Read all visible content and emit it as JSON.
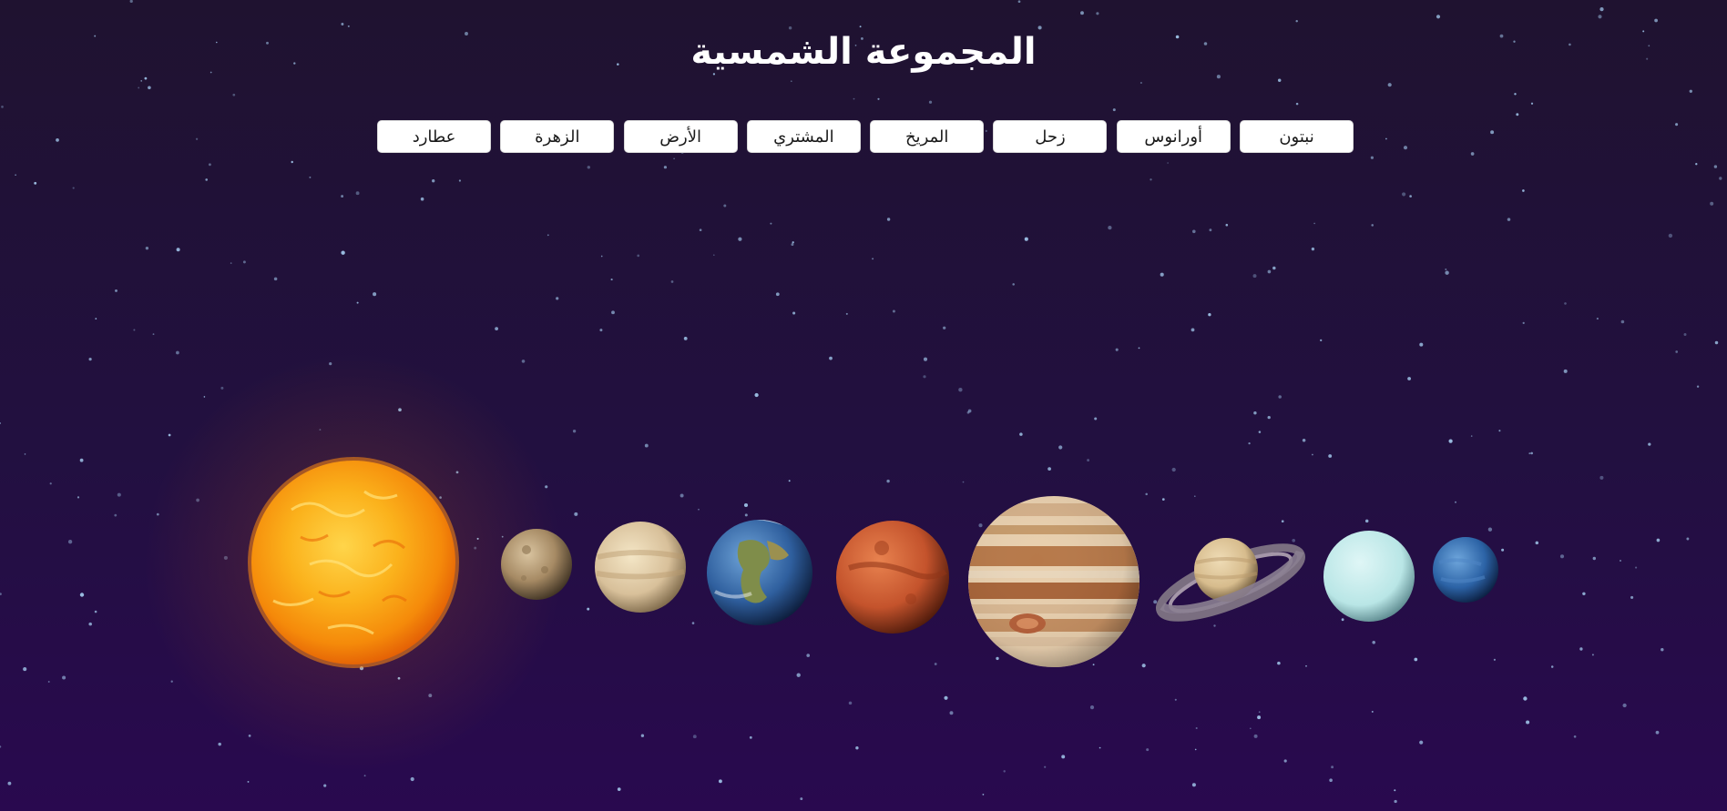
{
  "header": {
    "title": "المجموعة الشمسية"
  },
  "nav": {
    "buttons": [
      {
        "id": "neptune",
        "label": "نبتون"
      },
      {
        "id": "uranus",
        "label": "أورانوس"
      },
      {
        "id": "saturn",
        "label": "زحل"
      },
      {
        "id": "mars",
        "label": "المريخ"
      },
      {
        "id": "jupiter",
        "label": "المشتري"
      },
      {
        "id": "earth",
        "label": "الأرض"
      },
      {
        "id": "venus",
        "label": "الزهرة"
      },
      {
        "id": "mercury",
        "label": "عطارد"
      }
    ]
  },
  "colors": {
    "background_top": "#1f1230",
    "background_bottom": "#29094f",
    "star": "#9fc4e8",
    "sun": "#f7a412",
    "mercury": "#a68a64",
    "venus": "#d8c09a",
    "earth": "#2f5f9e",
    "mars": "#c4532c",
    "jupiter": "#d9b48a",
    "saturn": "#d7bc8d",
    "uranus": "#b9e6e6",
    "neptune": "#2c63a6"
  },
  "bodies": [
    "sun-icon",
    "mercury-icon",
    "venus-icon",
    "earth-icon",
    "mars-icon",
    "jupiter-icon",
    "saturn-icon",
    "uranus-icon",
    "neptune-icon"
  ]
}
